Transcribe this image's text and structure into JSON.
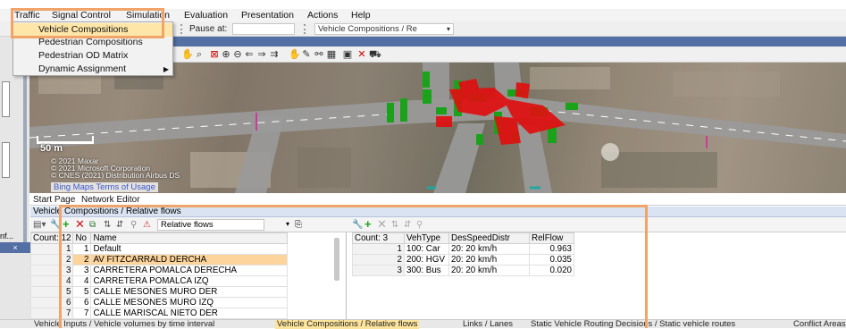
{
  "menu": {
    "items": [
      "Traffic",
      "Signal Control",
      "Simulation",
      "Evaluation",
      "Presentation",
      "Actions",
      "Help"
    ]
  },
  "dropdown": {
    "items": [
      {
        "label": "Vehicle Compositions",
        "highlighted": true
      },
      {
        "label": "Pedestrian Compositions"
      },
      {
        "label": "Pedestrian OD Matrix"
      },
      {
        "label": "Dynamic Assignment",
        "submenu": true
      }
    ]
  },
  "toolbar": {
    "pause_label": "Pause at:",
    "pause_value": "",
    "view_select": "Vehicle Compositions / Re"
  },
  "map": {
    "scale": "50 m",
    "copyright": [
      "© 2021 Maxar",
      "© 2021 Microsoft Corporation",
      "© CNES (2021) Distribution Airbus DS"
    ],
    "bing_link": "Bing Maps Terms of Usage",
    "colors": {
      "road": "#9a9a9a",
      "link": "#1aa31a",
      "conflict": "#e01010",
      "edge": "#cc3b9a"
    }
  },
  "doc_tabs": [
    "Start Page",
    "Network Editor"
  ],
  "panel": {
    "title": "Vehicle Compositions / Relative flows",
    "relative_flows_label": "Relative flows",
    "left_table": {
      "count_header": "Count: 12",
      "columns": [
        "No",
        "Name"
      ],
      "rows": [
        {
          "rn": "1",
          "no": "1",
          "name": "Default"
        },
        {
          "rn": "2",
          "no": "2",
          "name": "AV FITZCARRALD DERCHA",
          "selected": true
        },
        {
          "rn": "3",
          "no": "3",
          "name": "CARRETERA POMALCA DERECHA"
        },
        {
          "rn": "4",
          "no": "4",
          "name": "CARRETERA POMALCA IZQ"
        },
        {
          "rn": "5",
          "no": "5",
          "name": "CALLE MESONES MURO DER"
        },
        {
          "rn": "6",
          "no": "6",
          "name": "CALLE MESONES MURO IZQ"
        },
        {
          "rn": "7",
          "no": "7",
          "name": "CALLE MARISCAL NIETO DER"
        }
      ]
    },
    "right_table": {
      "count_header": "Count: 3",
      "columns": [
        "VehType",
        "DesSpeedDistr",
        "RelFlow"
      ],
      "rows": [
        {
          "rn": "1",
          "vehtype": "100: Car",
          "speed": "20: 20 km/h",
          "relflow": "0.963"
        },
        {
          "rn": "2",
          "vehtype": "200: HGV",
          "speed": "20: 20 km/h",
          "relflow": "0.035"
        },
        {
          "rn": "3",
          "vehtype": "300: Bus",
          "speed": "20: 20 km/h",
          "relflow": "0.020"
        }
      ]
    }
  },
  "bottom_tabs": [
    {
      "label": "Vehicle Inputs / Vehicle volumes by time interval"
    },
    {
      "label": "Vehicle Compositions / Relative flows",
      "active": true
    },
    {
      "label": "Links / Lanes"
    },
    {
      "label": "Static Vehicle Routing Decisions / Static vehicle routes"
    },
    {
      "label": "Conflict Areas"
    }
  ],
  "left_fragment": "nf...",
  "accents": {
    "highlight_box": "#f0a46a",
    "selection": "#fdd49b",
    "title_bar": "#546fa3"
  }
}
